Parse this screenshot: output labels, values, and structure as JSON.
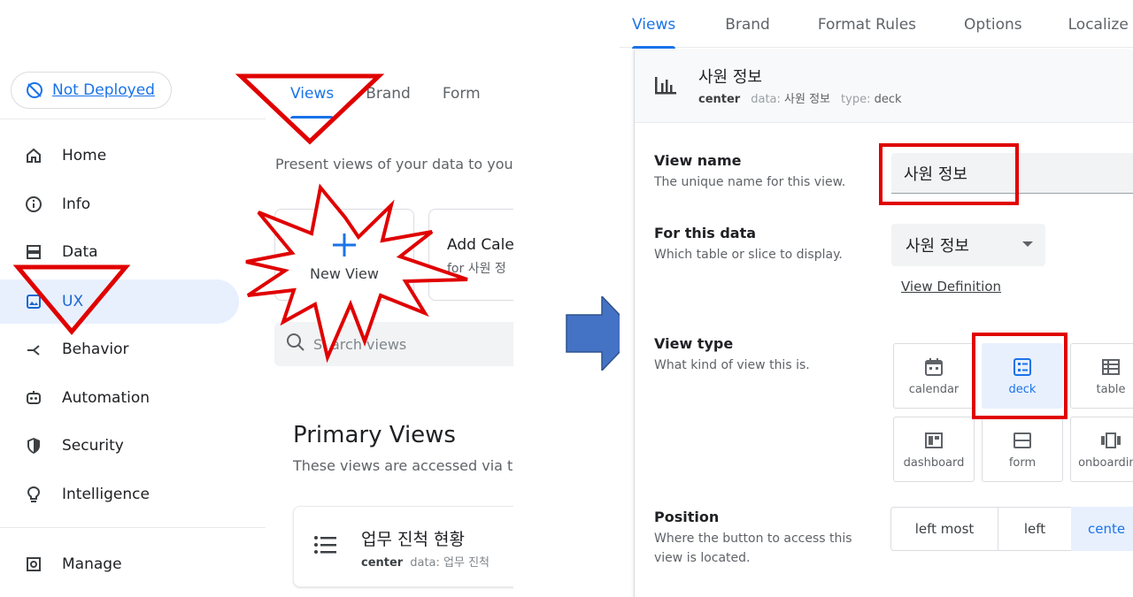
{
  "left": {
    "deploy_status": "Not Deployed",
    "nav": [
      {
        "label": "Home",
        "icon": "home-icon"
      },
      {
        "label": "Info",
        "icon": "info-icon"
      },
      {
        "label": "Data",
        "icon": "data-icon"
      },
      {
        "label": "UX",
        "icon": "ux-icon"
      },
      {
        "label": "Behavior",
        "icon": "behavior-icon"
      },
      {
        "label": "Automation",
        "icon": "automation-icon"
      },
      {
        "label": "Security",
        "icon": "security-icon"
      },
      {
        "label": "Intelligence",
        "icon": "intelligence-icon"
      },
      {
        "label": "Manage",
        "icon": "manage-icon"
      }
    ],
    "tabs": [
      "Views",
      "Brand",
      "Form"
    ],
    "subtitle": "Present views of your data to your",
    "new_view_label": "New View",
    "calendar_card_title": "Add Cale",
    "calendar_card_sub": "for 사원 정",
    "search_placeholder": "Search views",
    "primary_title": "Primary Views",
    "primary_sub": "These views are accessed via t",
    "view_row": {
      "name": "업무 진척 현황",
      "position": "center",
      "data_label": "data: 업무 진척"
    }
  },
  "right": {
    "tabs": [
      "Views",
      "Brand",
      "Format Rules",
      "Options",
      "Localize"
    ],
    "header": {
      "title": "사원 정보",
      "position": "center",
      "data_label": "data:",
      "data_value": "사원 정보",
      "type_label": "type:",
      "type_value": "deck"
    },
    "view_name": {
      "label": "View name",
      "desc": "The unique name for this view.",
      "value": "사원 정보"
    },
    "for_data": {
      "label": "For this data",
      "desc": "Which table or slice to display.",
      "value": "사원 정보",
      "link": "View Definition"
    },
    "view_type": {
      "label": "View type",
      "desc": "What kind of view this is.",
      "options": [
        "calendar",
        "deck",
        "table",
        "dashboard",
        "form",
        "onboarding"
      ],
      "selected": "deck"
    },
    "position": {
      "label": "Position",
      "desc_line1": "Where the button to access this",
      "desc_line2": "view is located.",
      "options": [
        "left most",
        "left",
        "cente"
      ],
      "selected": "cente"
    }
  },
  "colors": {
    "accent": "#1a73e8",
    "active_bg": "#e8f0fe",
    "annotation_red": "#e00000",
    "arrow_blue": "#4472c4"
  }
}
